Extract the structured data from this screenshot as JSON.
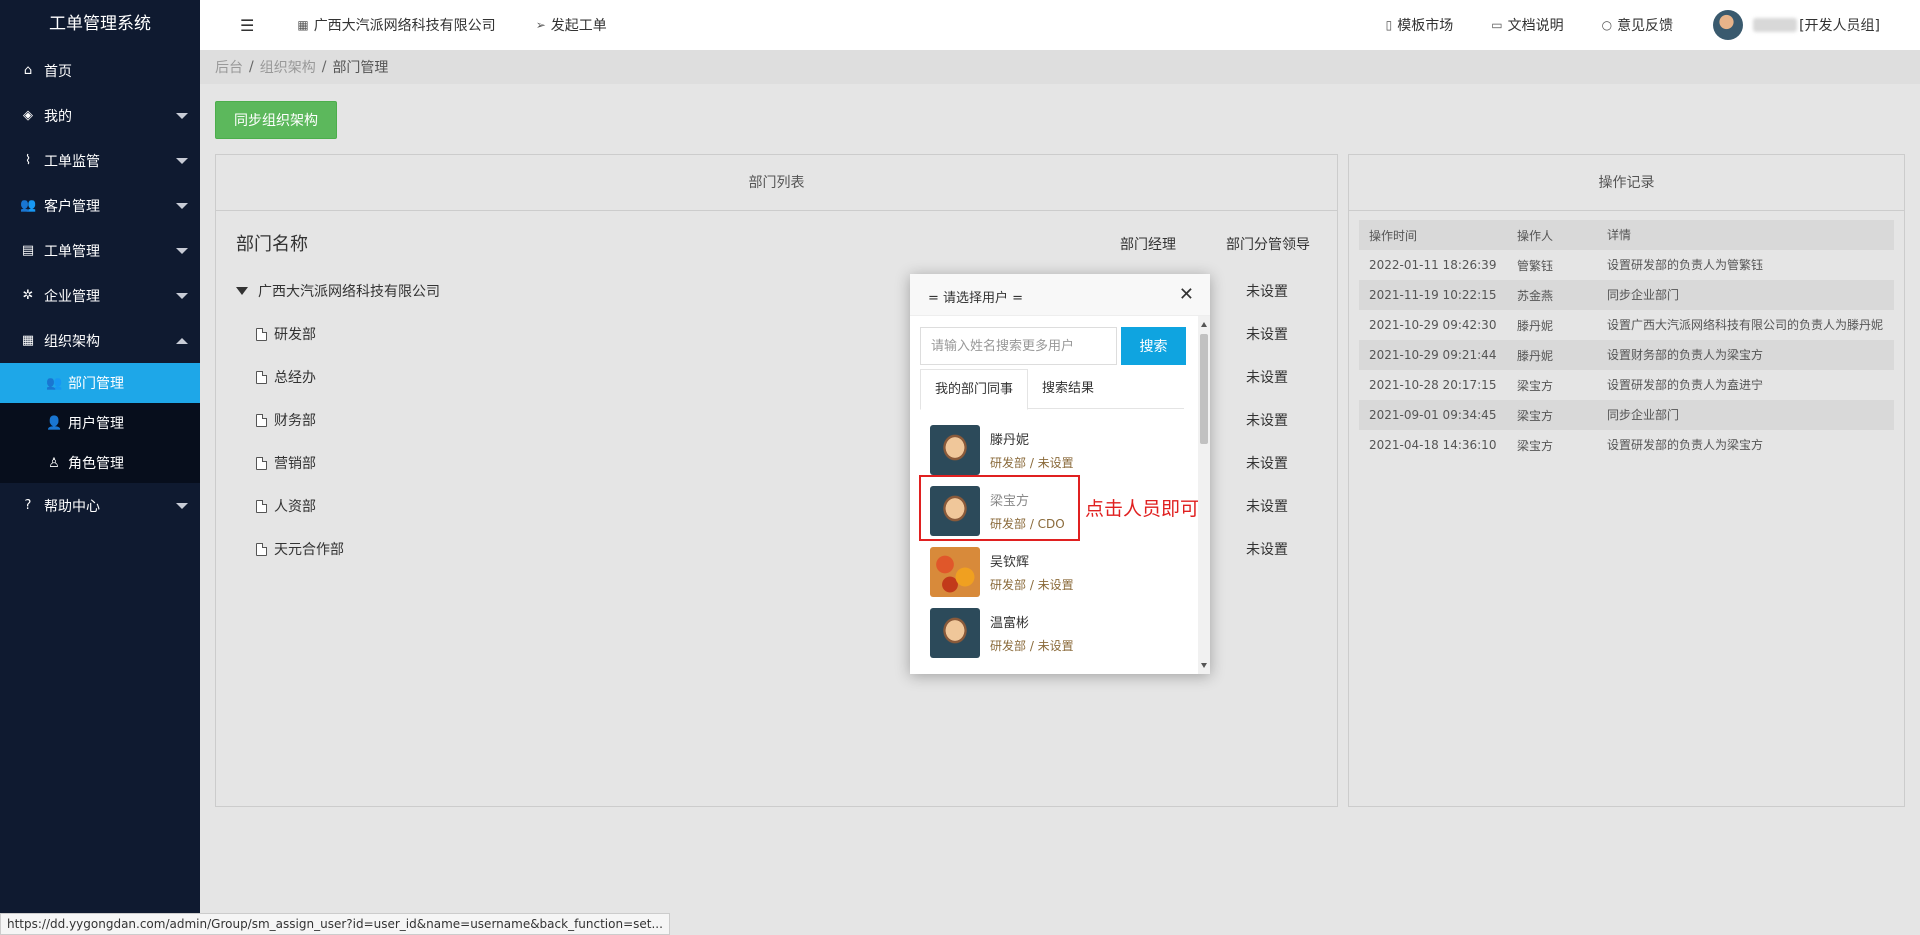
{
  "app": {
    "title": "工单管理系统"
  },
  "sidebar": {
    "items": [
      {
        "icon": "home-icon",
        "glyph": "⌂",
        "label": "首页",
        "caret": ""
      },
      {
        "icon": "layers-icon",
        "glyph": "◈",
        "label": "我的",
        "caret": "down"
      },
      {
        "icon": "pulse-icon",
        "glyph": "⌇",
        "label": "工单监管",
        "caret": "down"
      },
      {
        "icon": "users-icon",
        "glyph": "👥",
        "label": "客户管理",
        "caret": "down"
      },
      {
        "icon": "clipboard-icon",
        "glyph": "▤",
        "label": "工单管理",
        "caret": "down"
      },
      {
        "icon": "gear-icon",
        "glyph": "✲",
        "label": "企业管理",
        "caret": "down"
      },
      {
        "icon": "calendar-icon",
        "glyph": "▦",
        "label": "组织架构",
        "caret": "up"
      }
    ],
    "sub_items": [
      {
        "icon": "users-icon",
        "glyph": "👥",
        "label": "部门管理",
        "active": true
      },
      {
        "icon": "user-icon",
        "glyph": "👤",
        "label": "用户管理",
        "active": false
      },
      {
        "icon": "user-outline-icon",
        "glyph": "♙",
        "label": "角色管理",
        "active": false
      }
    ],
    "help": {
      "icon": "question-icon",
      "glyph": "?",
      "label": "帮助中心"
    }
  },
  "header": {
    "menu_icon": "menu-toggle-icon",
    "company": "广西大汽派网络科技有限公司",
    "new_order": "发起工单",
    "template_market": "模板市场",
    "docs": "文档说明",
    "feedback": "意见反馈",
    "user_group": "[开发人员组]"
  },
  "breadcrumb": {
    "items": [
      "后台",
      "组织架构",
      "部门管理"
    ]
  },
  "sync_button": "同步组织架构",
  "dept_panel": {
    "title": "部门列表",
    "col_name": "部门名称",
    "col_manager": "部门经理",
    "col_leader": "部门分管领导",
    "rows": [
      {
        "name": "广西大汽派网络科技有限公司",
        "manager": "",
        "leader": "未设置",
        "root": true
      },
      {
        "name": "研发部",
        "manager": "",
        "leader": "未设置",
        "root": false
      },
      {
        "name": "总经办",
        "manager": "",
        "leader": "未设置",
        "root": false
      },
      {
        "name": "财务部",
        "manager": "",
        "leader": "未设置",
        "root": false
      },
      {
        "name": "营销部",
        "manager": "",
        "leader": "未设置",
        "root": false
      },
      {
        "name": "人资部",
        "manager": "",
        "leader": "未设置",
        "root": false
      },
      {
        "name": "天元合作部",
        "manager": "",
        "leader": "未设置",
        "root": false
      }
    ]
  },
  "log_panel": {
    "title": "操作记录",
    "headers": [
      "操作时间",
      "操作人",
      "详情"
    ],
    "rows": [
      [
        "2022-01-11 18:26:39",
        "管繁钰",
        "设置研发部的负责人为管繁钰"
      ],
      [
        "2021-11-19 10:22:15",
        "苏金燕",
        "同步企业部门"
      ],
      [
        "2021-10-29 09:42:30",
        "滕丹妮",
        "设置广西大汽派网络科技有限公司的负责人为滕丹妮"
      ],
      [
        "2021-10-29 09:21:44",
        "滕丹妮",
        "设置财务部的负责人为梁宝方"
      ],
      [
        "2021-10-28 20:17:15",
        "梁宝方",
        "设置研发部的负责人为盍进宁"
      ],
      [
        "2021-09-01 09:34:45",
        "梁宝方",
        "同步企业部门"
      ],
      [
        "2021-04-18 14:36:10",
        "梁宝方",
        "设置研发部的负责人为梁宝方"
      ]
    ]
  },
  "modal": {
    "title": "= 请选择用户 =",
    "close": "✕",
    "search_placeholder": "请输入姓名搜索更多用户",
    "search_button": "搜索",
    "tabs": [
      "我的部门同事",
      "搜索结果"
    ],
    "users": [
      {
        "name": "滕丹妮",
        "dept": "研发部 / 未设置",
        "avatar": "kid"
      },
      {
        "name": "梁宝方",
        "dept": "研发部 / CDO",
        "avatar": "kid"
      },
      {
        "name": "吴钦辉",
        "dept": "研发部 / 未设置",
        "avatar": "fruit"
      },
      {
        "name": "温富彬",
        "dept": "研发部 / 未设置",
        "avatar": "kid"
      },
      {
        "name": "",
        "dept": "",
        "avatar": "blue"
      }
    ]
  },
  "annotation": "点击人员即可",
  "status_url": "https://dd.yygongdan.com/admin/Group/sm_assign_user?id=user_id&name=username&back_function=set...",
  "colors": {
    "sidebar": "#0f1a30",
    "active": "#1ea7e8",
    "sync": "#5cb85c",
    "search": "#0fa4e0",
    "annotation": "#e02020"
  }
}
